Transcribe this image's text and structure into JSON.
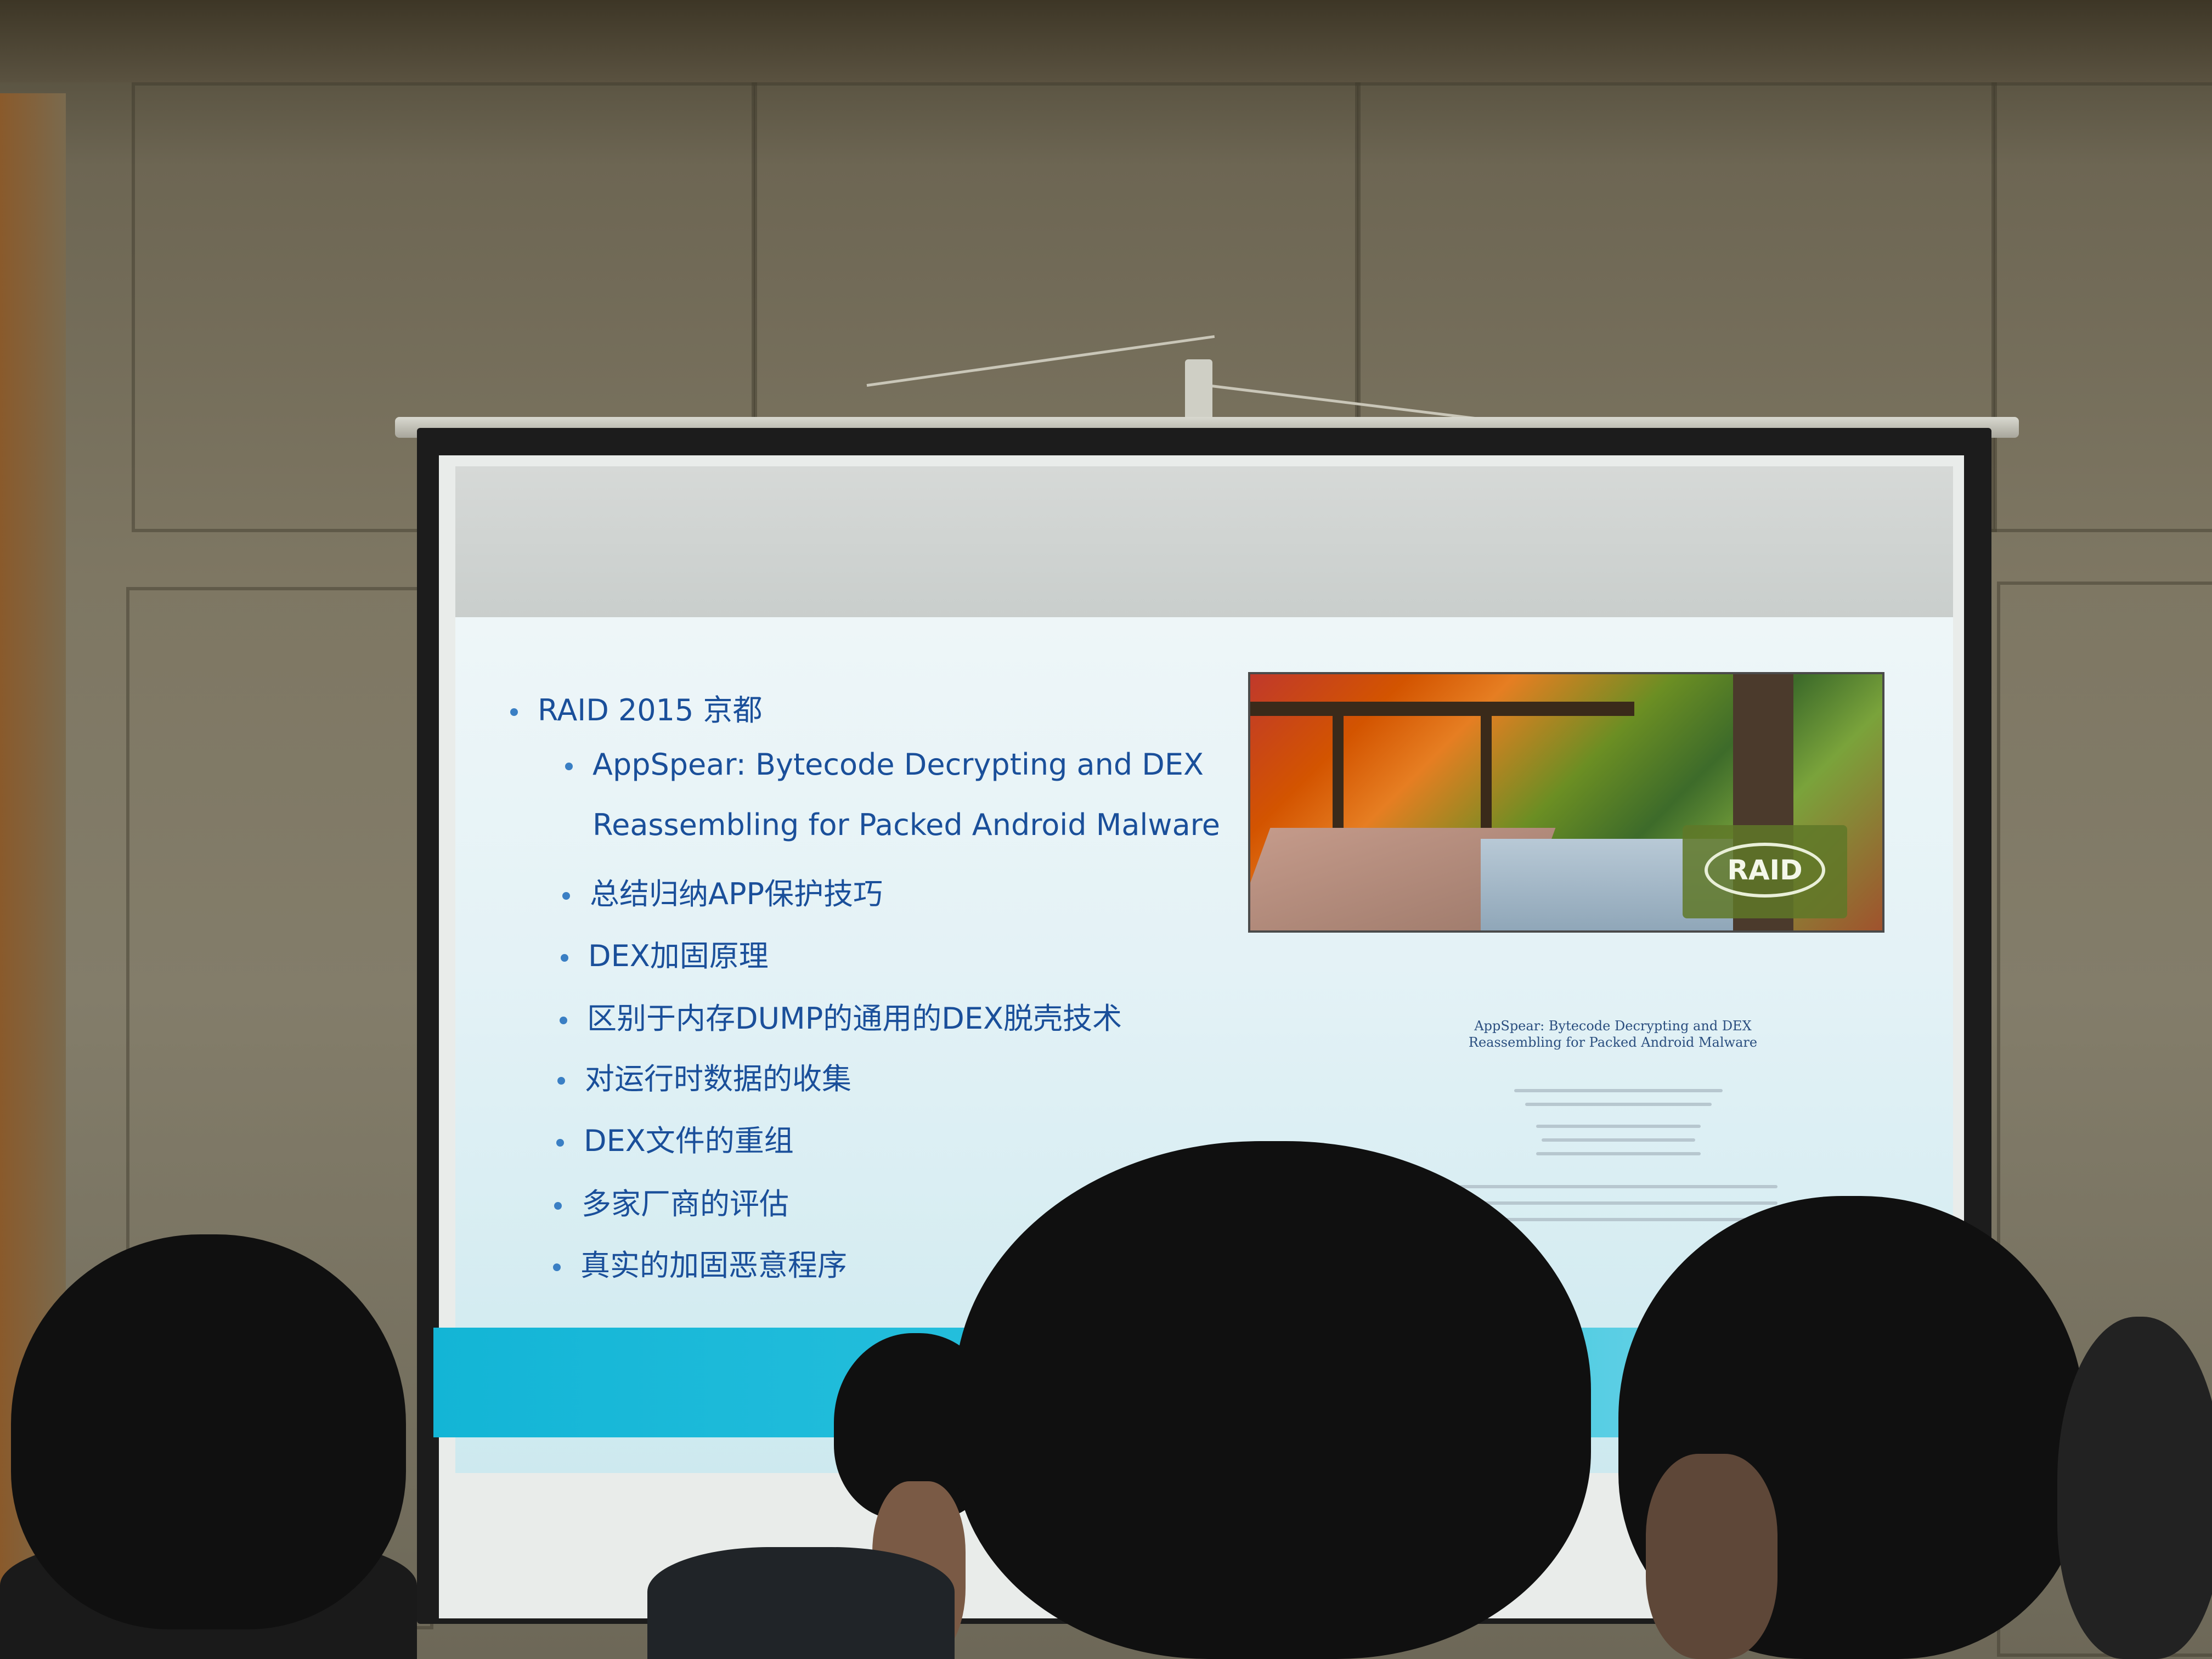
{
  "slide": {
    "bullets": [
      {
        "level": 1,
        "text": "RAID 2015 京都"
      },
      {
        "level": 2,
        "text": "AppSpear: Bytecode Decrypting and DEX"
      },
      {
        "level": 2,
        "text": "Reassembling for Packed Android Malware",
        "continuation": true
      },
      {
        "level": 2,
        "text": "总结归纳APP保护技巧"
      },
      {
        "level": 2,
        "text": "DEX加固原理"
      },
      {
        "level": 2,
        "text": "区别于内存DUMP的通用的DEX脱壳技术"
      },
      {
        "level": 2,
        "text": "对运行时数据的收集"
      },
      {
        "level": 2,
        "text": "DEX文件的重组"
      },
      {
        "level": 2,
        "text": "多家厂商的评估"
      },
      {
        "level": 2,
        "text": "真实的加固恶意程序"
      }
    ],
    "picture": {
      "logo_text": "RAID",
      "icon": "raid-conference-logo"
    },
    "paper": {
      "title_line1": "AppSpear: Bytecode Decrypting and DEX",
      "title_line2": "Reassembling for Packed Android Malware"
    }
  },
  "colors": {
    "bullet_text": "#1a4f9a",
    "band": "#13b5d6",
    "slide_bg": "#e4f2f6"
  }
}
